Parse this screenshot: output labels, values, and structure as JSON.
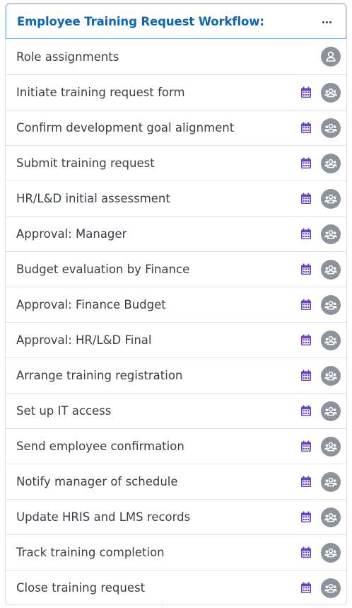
{
  "workflow": {
    "title": "Employee Training Request Workflow:",
    "menu_icon": "more-horizontal-icon",
    "rows": [
      {
        "label": "Role assignments",
        "has_calendar": false,
        "avatar": "single-user-icon"
      },
      {
        "label": "Initiate training request form",
        "has_calendar": true,
        "avatar": "group-users-icon"
      },
      {
        "label": "Confirm development goal alignment",
        "has_calendar": true,
        "avatar": "group-users-icon"
      },
      {
        "label": "Submit training request",
        "has_calendar": true,
        "avatar": "group-users-icon"
      },
      {
        "label": "HR/L&D initial assessment",
        "has_calendar": true,
        "avatar": "group-users-icon"
      },
      {
        "label": "Approval: Manager",
        "has_calendar": true,
        "avatar": "group-users-icon"
      },
      {
        "label": "Budget evaluation by Finance",
        "has_calendar": true,
        "avatar": "group-users-icon"
      },
      {
        "label": "Approval: Finance Budget",
        "has_calendar": true,
        "avatar": "group-users-icon"
      },
      {
        "label": "Approval: HR/L&D Final",
        "has_calendar": true,
        "avatar": "group-users-icon"
      },
      {
        "label": "Arrange training registration",
        "has_calendar": true,
        "avatar": "group-users-icon"
      },
      {
        "label": "Set up IT access",
        "has_calendar": true,
        "avatar": "group-users-icon"
      },
      {
        "label": "Send employee confirmation",
        "has_calendar": true,
        "avatar": "group-users-icon"
      },
      {
        "label": "Notify manager of schedule",
        "has_calendar": true,
        "avatar": "group-users-icon"
      },
      {
        "label": "Update HRIS and LMS records",
        "has_calendar": true,
        "avatar": "group-users-icon"
      },
      {
        "label": "Track training completion",
        "has_calendar": true,
        "avatar": "group-users-icon"
      },
      {
        "label": "Close training request",
        "has_calendar": true,
        "avatar": "group-users-icon"
      }
    ]
  },
  "colors": {
    "title": "#0a66b8",
    "header_border": "#7ab0e3",
    "calendar": "#6a3fd1",
    "avatar_bg": "#8c939d",
    "row_text": "#3b4046"
  }
}
